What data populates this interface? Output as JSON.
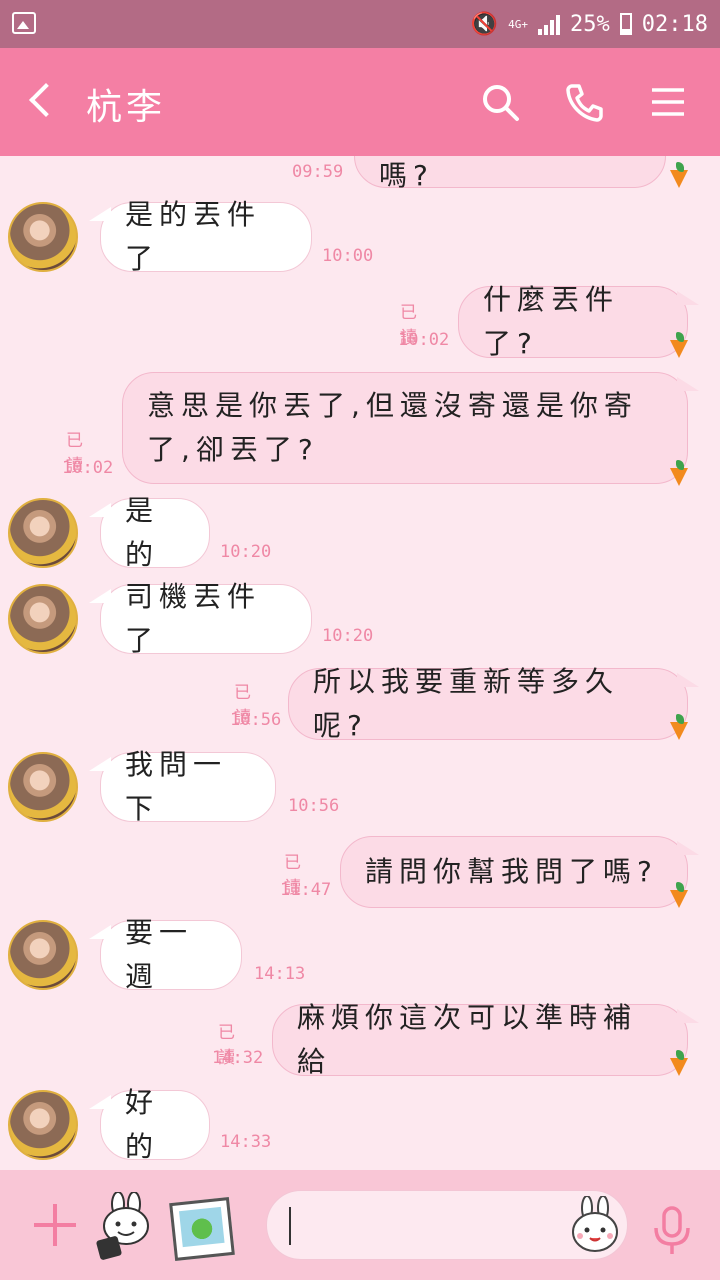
{
  "status_bar": {
    "network": "4G+",
    "battery": "25%",
    "time": "02:18"
  },
  "header": {
    "title": "杭李"
  },
  "messages": [
    {
      "side": "out",
      "text": "催促?你還沒寄嗎?",
      "time": "09:59"
    },
    {
      "side": "in",
      "text": "是的丟件了",
      "time": "10:00"
    },
    {
      "side": "out",
      "text": "什麼丟件了?",
      "time": "10:02",
      "read": "已讀"
    },
    {
      "side": "out",
      "text_line1": "意思是你丟了,但還沒寄還是你寄",
      "text_line2": "了,卻丟了?",
      "time": "10:02",
      "read": "已讀"
    },
    {
      "side": "in",
      "text": "是的",
      "time": "10:20"
    },
    {
      "side": "in",
      "text": "司機丟件了",
      "time": "10:20"
    },
    {
      "side": "out",
      "text": "所以我要重新等多久呢?",
      "time": "10:56",
      "read": "已讀"
    },
    {
      "side": "in",
      "text": "我問一下",
      "time": "10:56"
    },
    {
      "side": "out",
      "text": "請問你幫我問了嗎?",
      "time": "11:47",
      "read": "已讀"
    },
    {
      "side": "in",
      "text": "要一週",
      "time": "14:13"
    },
    {
      "side": "out",
      "text": "麻煩你這次可以準時補給",
      "time": "14:32",
      "read": "已讀"
    },
    {
      "side": "in",
      "text": "好的",
      "time": "14:33"
    }
  ]
}
